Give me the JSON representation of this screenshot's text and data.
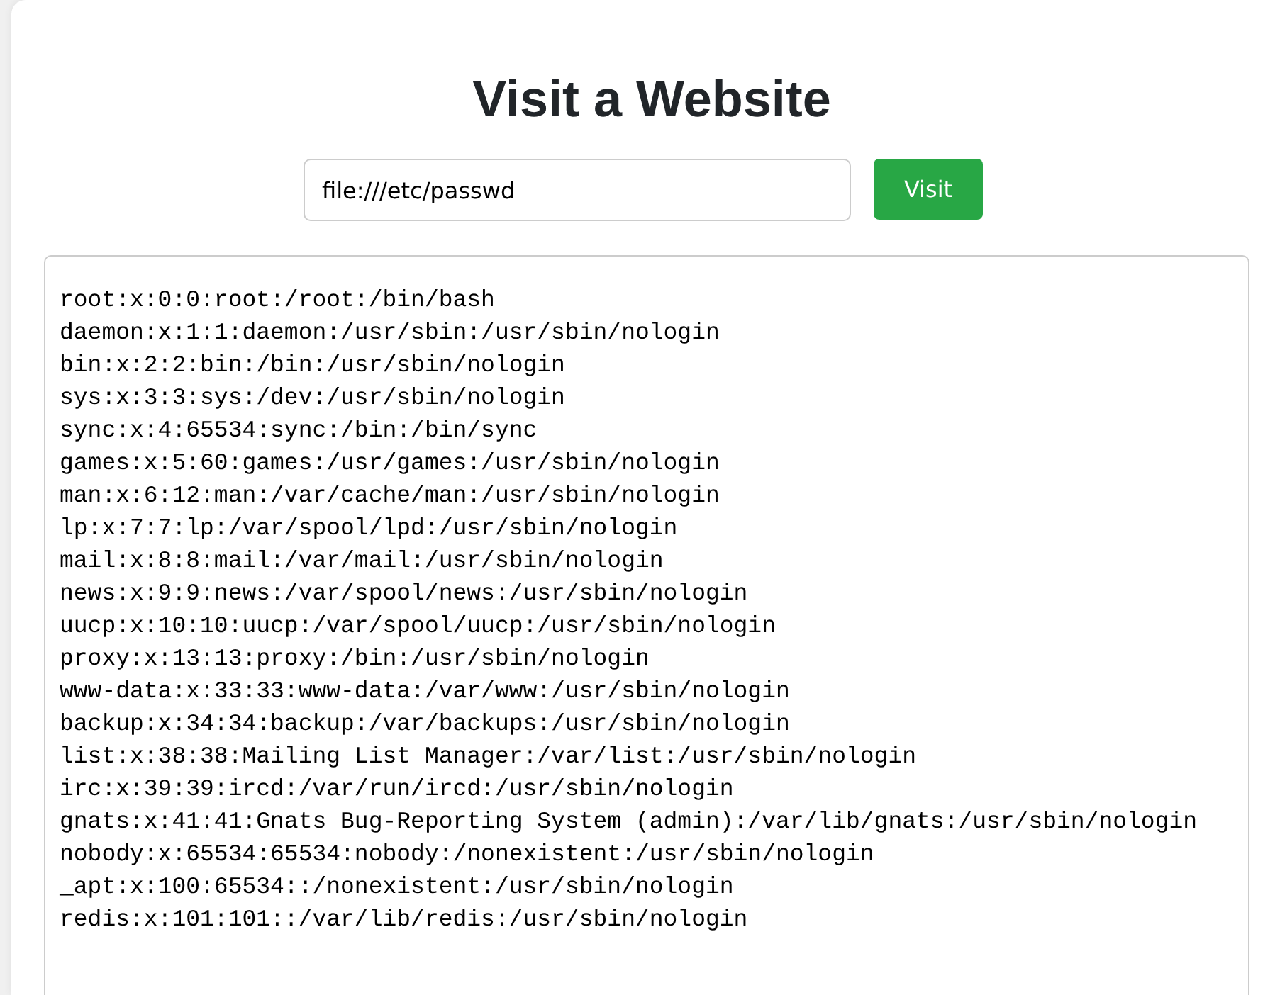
{
  "title": "Visit a Website",
  "url_field": {
    "value": "file:///etc/passwd"
  },
  "visit_button": {
    "label": "Visit"
  },
  "output_lines": [
    "root:x:0:0:root:/root:/bin/bash",
    "daemon:x:1:1:daemon:/usr/sbin:/usr/sbin/nologin",
    "bin:x:2:2:bin:/bin:/usr/sbin/nologin",
    "sys:x:3:3:sys:/dev:/usr/sbin/nologin",
    "sync:x:4:65534:sync:/bin:/bin/sync",
    "games:x:5:60:games:/usr/games:/usr/sbin/nologin",
    "man:x:6:12:man:/var/cache/man:/usr/sbin/nologin",
    "lp:x:7:7:lp:/var/spool/lpd:/usr/sbin/nologin",
    "mail:x:8:8:mail:/var/mail:/usr/sbin/nologin",
    "news:x:9:9:news:/var/spool/news:/usr/sbin/nologin",
    "uucp:x:10:10:uucp:/var/spool/uucp:/usr/sbin/nologin",
    "proxy:x:13:13:proxy:/bin:/usr/sbin/nologin",
    "www-data:x:33:33:www-data:/var/www:/usr/sbin/nologin",
    "backup:x:34:34:backup:/var/backups:/usr/sbin/nologin",
    "list:x:38:38:Mailing List Manager:/var/list:/usr/sbin/nologin",
    "irc:x:39:39:ircd:/var/run/ircd:/usr/sbin/nologin",
    "gnats:x:41:41:Gnats Bug-Reporting System (admin):/var/lib/gnats:/usr/sbin/nologin",
    "nobody:x:65534:65534:nobody:/nonexistent:/usr/sbin/nologin",
    "_apt:x:100:65534::/nonexistent:/usr/sbin/nologin",
    "redis:x:101:101::/var/lib/redis:/usr/sbin/nologin"
  ]
}
